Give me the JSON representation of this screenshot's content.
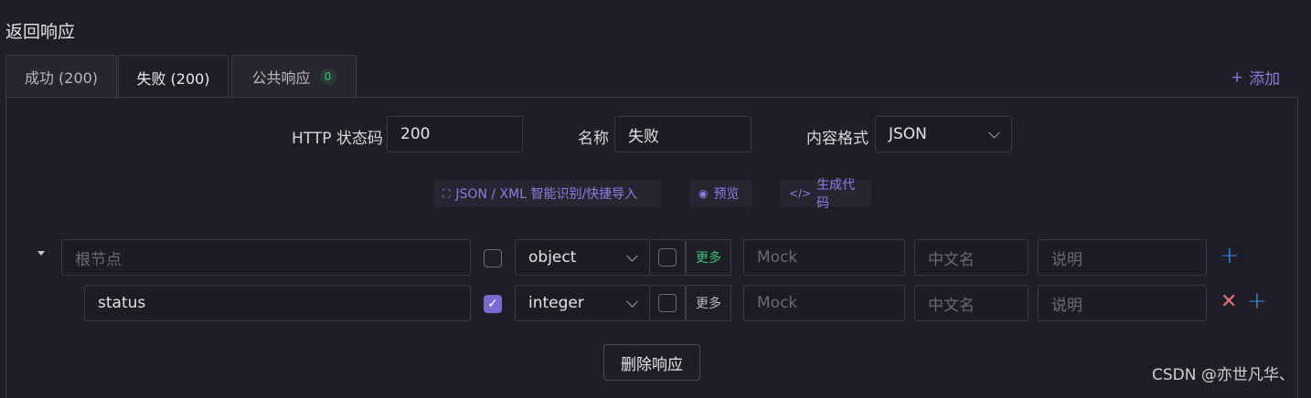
{
  "section_title": "返回响应",
  "tabs": [
    {
      "label": "成功 (200)"
    },
    {
      "label": "失败 (200)"
    },
    {
      "label": "公共响应",
      "badge": "0"
    }
  ],
  "add_label": "添加",
  "form": {
    "status_code_label": "HTTP 状态码",
    "status_code_value": "200",
    "name_label": "名称",
    "name_value": "失败",
    "format_label": "内容格式",
    "format_value": "JSON"
  },
  "tools": {
    "import_label": "JSON / XML 智能识别/快捷导入",
    "preview_label": "预览",
    "codegen_label": "生成代码"
  },
  "rows": [
    {
      "name_placeholder": "根节点",
      "type": "object",
      "more": "更多",
      "mock": "Mock",
      "cn_name": "中文名",
      "desc": "说明"
    },
    {
      "name": "status",
      "type": "integer",
      "more": "更多",
      "mock": "Mock",
      "cn_name": "中文名",
      "desc": "说明"
    }
  ],
  "delete_label": "删除响应",
  "watermark": "CSDN @亦世凡华、",
  "colors": {
    "accent": "#7b6bd0",
    "link": "#8b7bd8",
    "plus": "#3b8fe8",
    "danger": "#e4707b",
    "more_green": "#3bbf7a"
  }
}
